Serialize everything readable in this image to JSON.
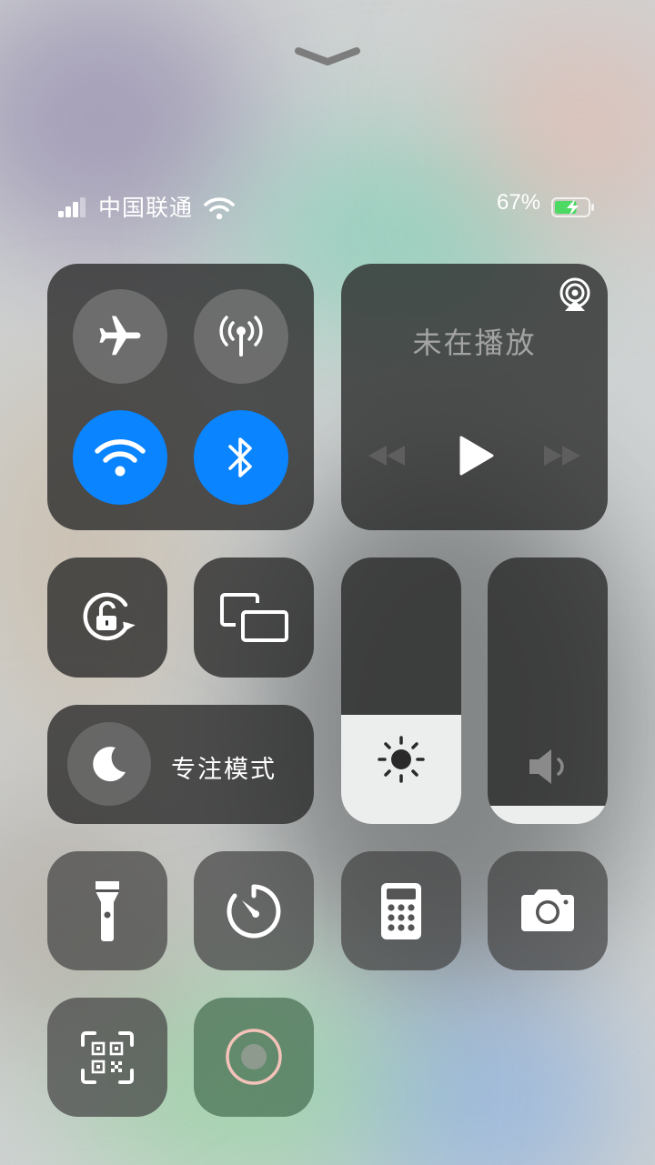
{
  "status_bar": {
    "carrier": "中国联通",
    "battery_percent": "67%",
    "signal_bars": 3,
    "signal_bars_total": 4,
    "wifi_connected": true,
    "charging": true
  },
  "connectivity": {
    "airplane_mode": false,
    "cellular_data": false,
    "wifi": true,
    "bluetooth": true
  },
  "media": {
    "now_playing": "未在播放"
  },
  "focus": {
    "label": "专注模式"
  },
  "sliders": {
    "brightness": 0.41,
    "volume": 0.07
  },
  "icons": [
    "chevron-down-icon",
    "airplane-icon",
    "cellular-antenna-icon",
    "wifi-icon",
    "bluetooth-icon",
    "airplay-audio-icon",
    "rewind-icon",
    "play-icon",
    "fast-forward-icon",
    "rotation-lock-icon",
    "screen-mirroring-icon",
    "moon-icon",
    "sun-icon",
    "speaker-icon",
    "flashlight-icon",
    "timer-icon",
    "calculator-icon",
    "camera-icon",
    "qr-code-scanner-icon",
    "screen-record-icon"
  ],
  "colors": {
    "accent_blue": "#0a84ff",
    "battery_green": "#4cd964",
    "record_ring": "#f3c2b8"
  }
}
